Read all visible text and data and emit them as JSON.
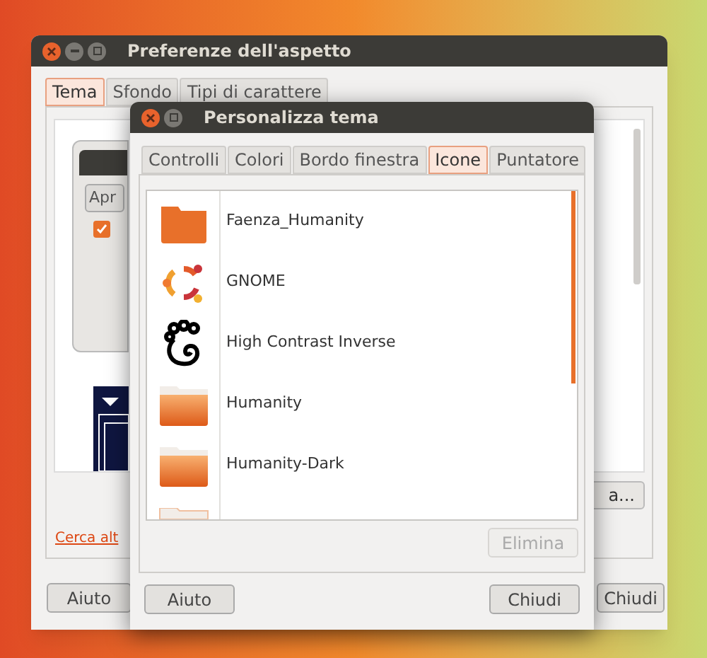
{
  "back_window": {
    "title": "Preferenze dell'aspetto",
    "tabs": [
      {
        "label": "Tema",
        "selected": true
      },
      {
        "label": "Sfondo",
        "selected": false
      },
      {
        "label": "Tipi di carattere",
        "selected": false
      }
    ],
    "preview": {
      "button": "Apr",
      "checked": true
    },
    "link": "Cerca alt",
    "side_button": "a...",
    "buttons": [
      "Aiuto",
      "Chiudi"
    ]
  },
  "dialog": {
    "title": "Personalizza tema",
    "tabs": [
      {
        "label": "Controlli",
        "selected": false
      },
      {
        "label": "Colori",
        "selected": false
      },
      {
        "label": "Bordo finestra",
        "selected": false
      },
      {
        "label": "Icone",
        "selected": true
      },
      {
        "label": "Puntatore",
        "selected": false
      }
    ],
    "icon_themes": [
      {
        "name": "Faenza_Humanity",
        "kind": "flat-folder"
      },
      {
        "name": "GNOME",
        "kind": "ring"
      },
      {
        "name": "High Contrast Inverse",
        "kind": "foot"
      },
      {
        "name": "Humanity",
        "kind": "folder"
      },
      {
        "name": "Humanity-Dark",
        "kind": "folder"
      },
      {
        "kind": "folder"
      }
    ],
    "delete_button": {
      "label": "Elimina",
      "disabled": true
    },
    "buttons": [
      "Aiuto",
      "Chiudi"
    ]
  }
}
